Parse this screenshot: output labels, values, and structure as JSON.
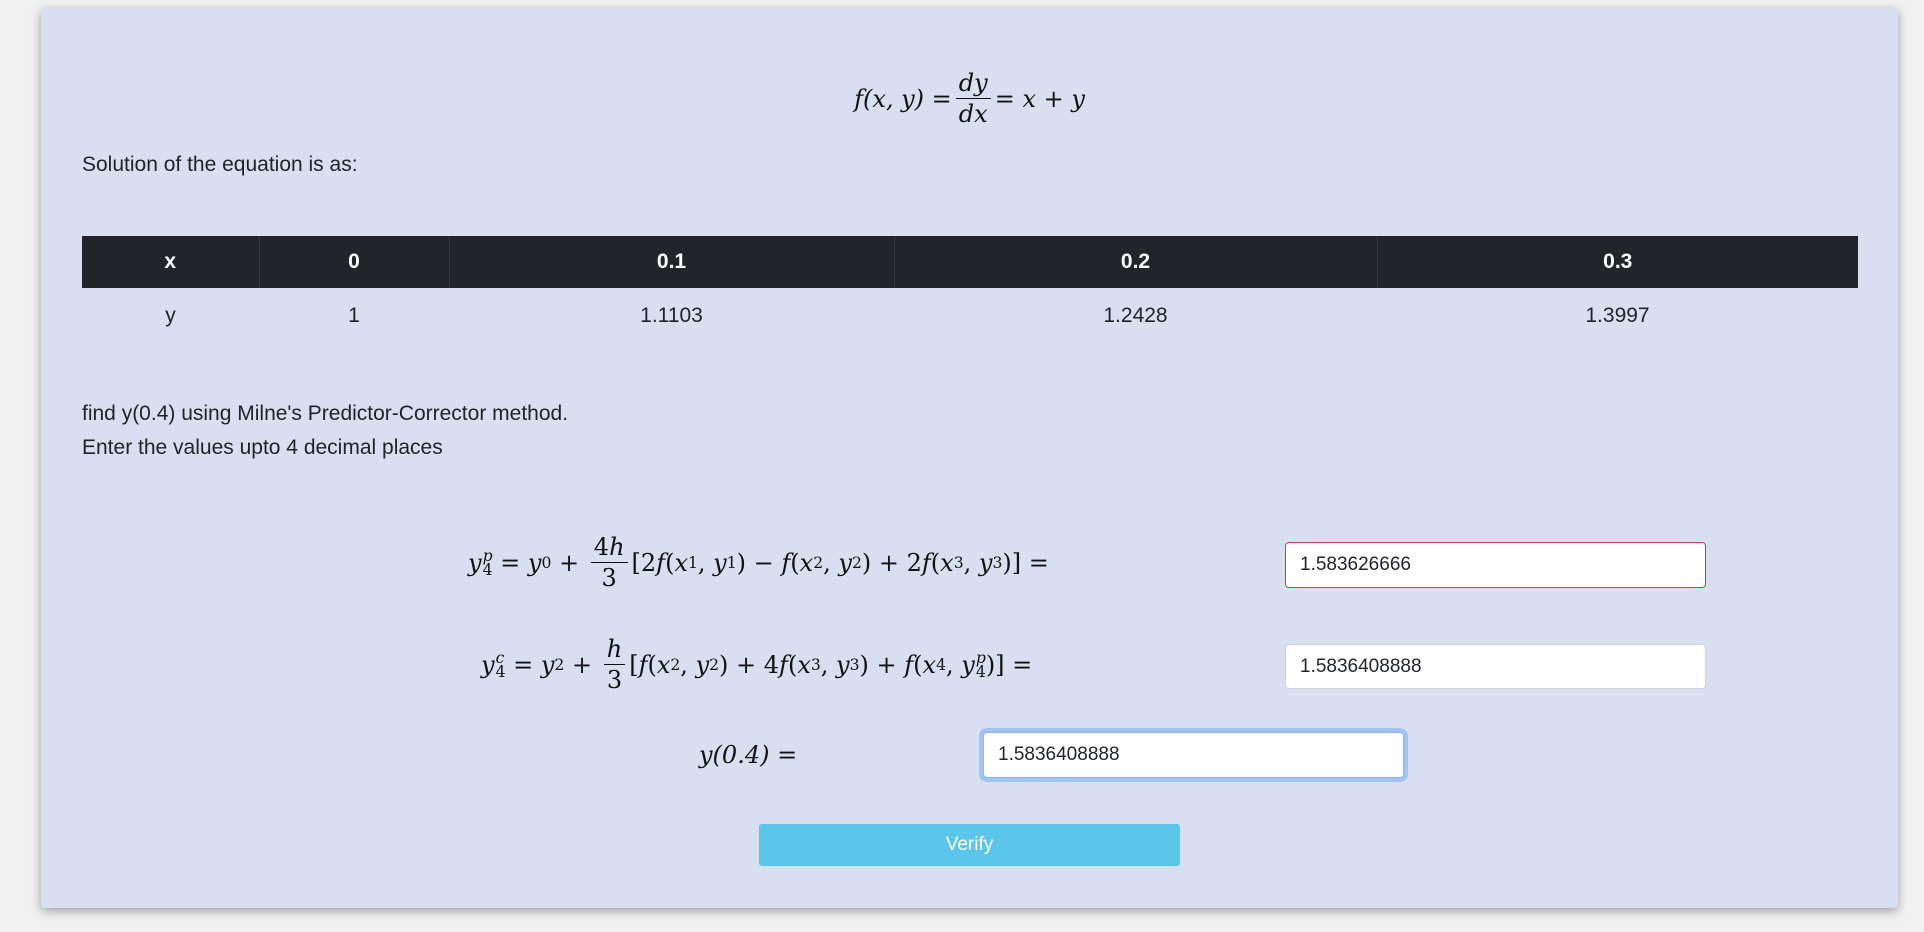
{
  "equation": {
    "lhs": "f(x, y) =",
    "frac_num": "dy",
    "frac_den": "dx",
    "rhs": "= x + y"
  },
  "solution_label": "Solution of the equation is as:",
  "table": {
    "header": [
      "x",
      "0",
      "0.1",
      "0.2",
      "0.3"
    ],
    "row": [
      "y",
      "1",
      "1.1103",
      "1.2428",
      "1.3997"
    ]
  },
  "prompt": {
    "line1": "find y(0.4) using Milne's Predictor-Corrector method.",
    "line2": "Enter the values upto 4 decimal places"
  },
  "predictor": {
    "value": "1.583626666",
    "state": "error"
  },
  "corrector": {
    "value": "1.5836408888",
    "state": "normal"
  },
  "result": {
    "label": "y(0.4) =",
    "value": "1.5836408888",
    "state": "focused"
  },
  "verify_label": "Verify",
  "colors": {
    "panel_bg": "#d6e0f0",
    "table_header_bg": "#212529",
    "error_border": "#dc3545",
    "focus_ring": "#86b7fe",
    "button_bg": "#5bc6ea"
  }
}
